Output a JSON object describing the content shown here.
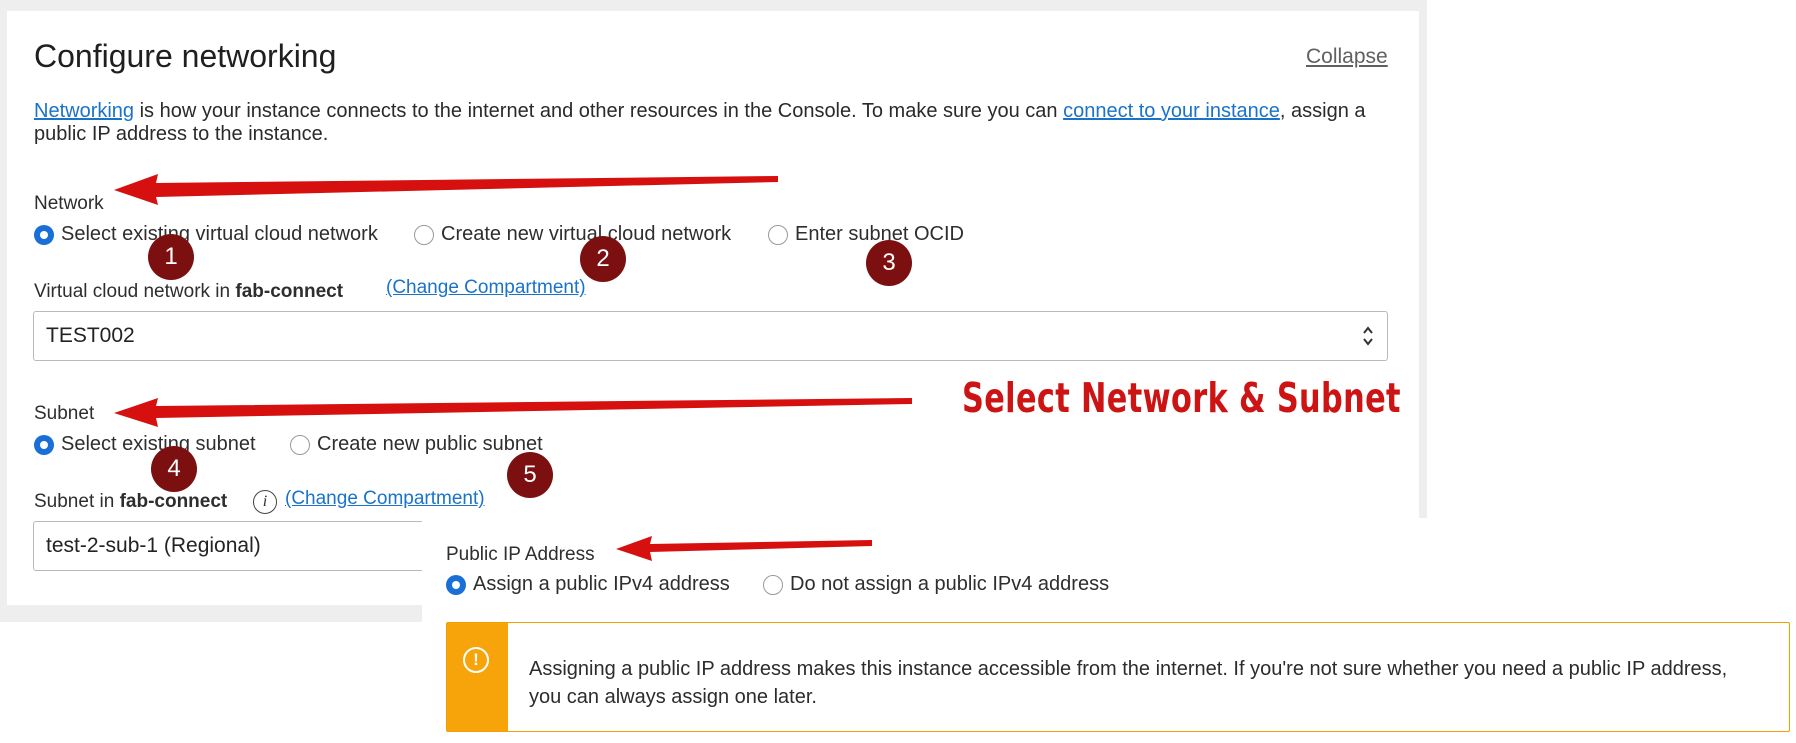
{
  "panel": {
    "title": "Configure networking",
    "collapse_label": "Collapse",
    "intro": {
      "link1": "Networking",
      "text1": " is how your instance connects to the internet and other resources in the Console. To make sure you can ",
      "link2": "connect to your instance",
      "text2": ", assign a public IP address to the instance."
    }
  },
  "network": {
    "label": "Network",
    "options": [
      {
        "label": "Select existing virtual cloud network",
        "selected": true
      },
      {
        "label": "Create new virtual cloud network",
        "selected": false
      },
      {
        "label": "Enter subnet OCID",
        "selected": false
      }
    ],
    "vcn_label_prefix": "Virtual cloud network in ",
    "compartment": "fab-connect",
    "change_compartment": "(Change Compartment)",
    "selected_vcn": "TEST002"
  },
  "subnet": {
    "label": "Subnet",
    "options": [
      {
        "label": "Select existing subnet",
        "selected": true
      },
      {
        "label": "Create new public subnet",
        "selected": false
      }
    ],
    "subnet_label_prefix": "Subnet in ",
    "compartment": "fab-connect",
    "change_compartment": "(Change Compartment)",
    "selected_subnet": "test-2-sub-1 (Regional)"
  },
  "public_ip": {
    "label": "Public IP Address",
    "options": [
      {
        "label": "Assign a public IPv4 address",
        "selected": true
      },
      {
        "label": "Do not assign a public IPv4 address",
        "selected": false
      }
    ],
    "warning_icon": "!",
    "warning": "Assigning a public IP address makes this instance accessible from the internet. If you're not sure whether you need a public IP address, you can always assign one later."
  },
  "annotations": {
    "title": "Select Network & Subnet",
    "badges": [
      "1",
      "2",
      "3",
      "4",
      "5"
    ],
    "color": "#cc1414",
    "badge_color": "#7c1010"
  },
  "colors": {
    "link": "#1a73c9",
    "radio_selected": "#1a6fd6",
    "warning": "#f7a40a"
  }
}
